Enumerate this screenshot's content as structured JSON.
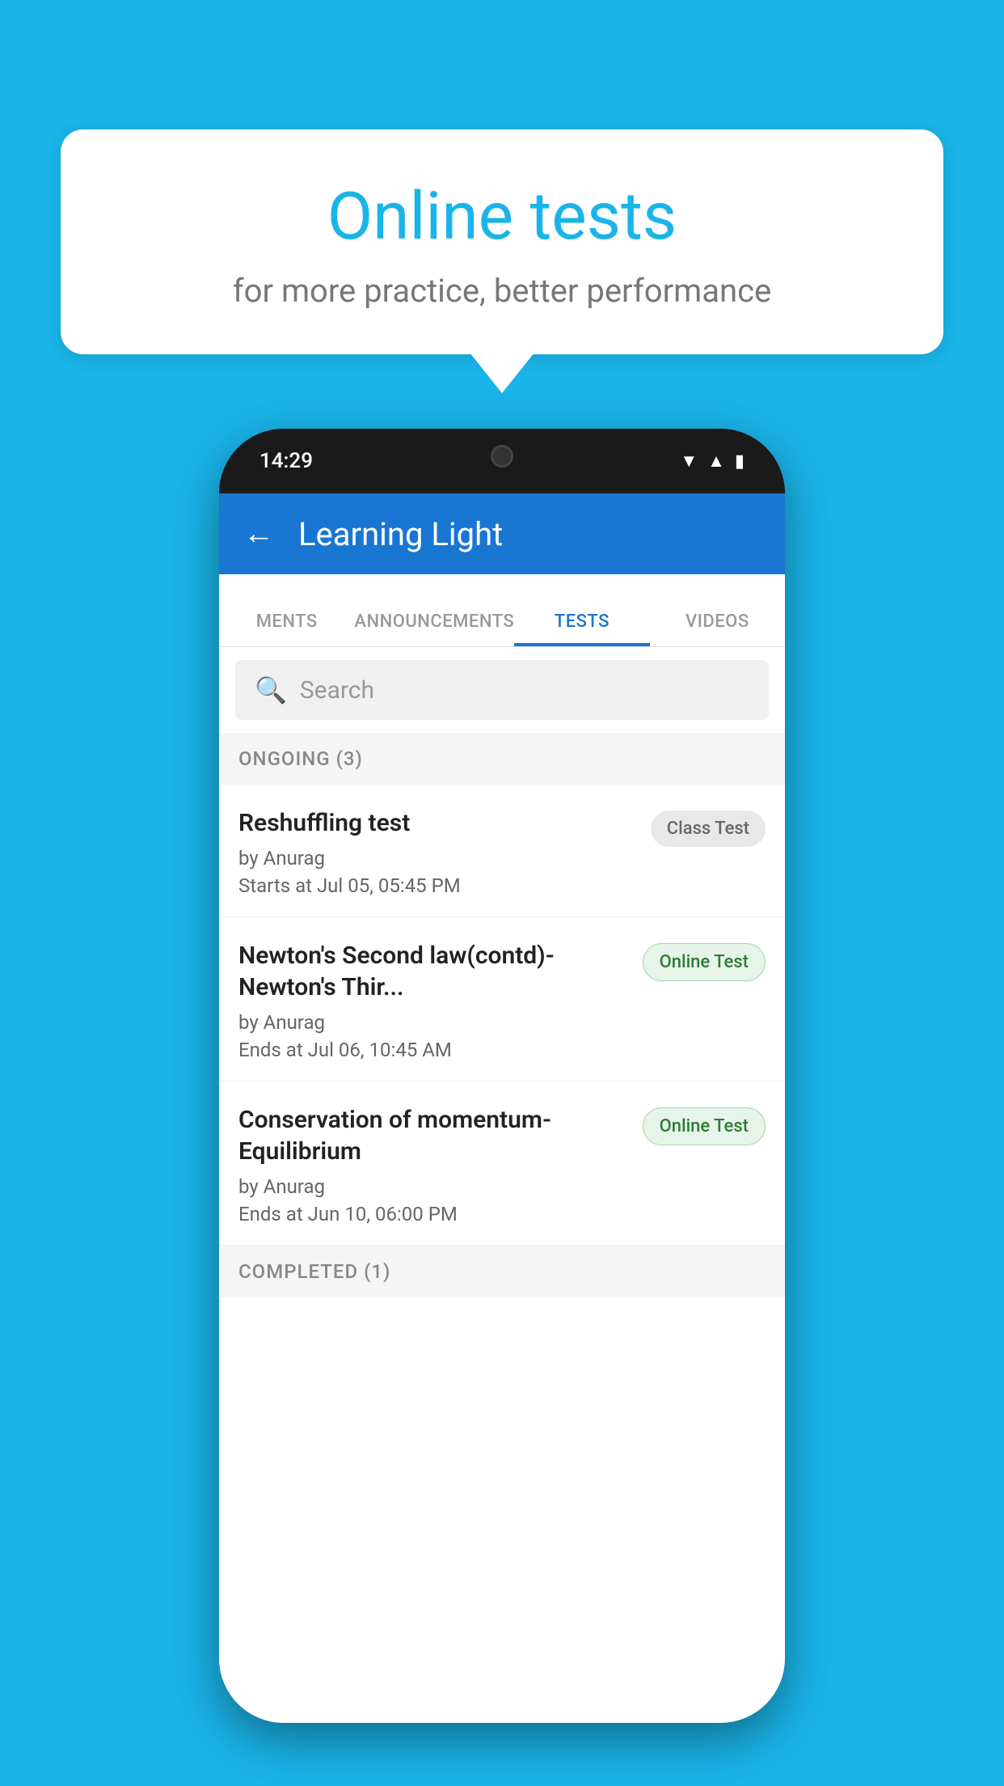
{
  "background": {
    "color": "#1ab4e8"
  },
  "speech_bubble": {
    "title": "Online tests",
    "subtitle": "for more practice, better performance"
  },
  "phone": {
    "status_bar": {
      "time": "14:29",
      "icons": [
        "wifi",
        "signal",
        "battery"
      ]
    },
    "header": {
      "back_label": "←",
      "title": "Learning Light"
    },
    "tabs": [
      {
        "label": "MENTS",
        "active": false
      },
      {
        "label": "ANNOUNCEMENTS",
        "active": false
      },
      {
        "label": "TESTS",
        "active": true
      },
      {
        "label": "VIDEOS",
        "active": false
      }
    ],
    "search": {
      "placeholder": "Search"
    },
    "sections": [
      {
        "label": "ONGOING (3)",
        "tests": [
          {
            "name": "Reshuffling test",
            "author": "by Anurag",
            "time_label": "Starts at",
            "time": "Jul 05, 05:45 PM",
            "badge": "Class Test",
            "badge_type": "class"
          },
          {
            "name": "Newton's Second law(contd)-Newton's Thir...",
            "author": "by Anurag",
            "time_label": "Ends at",
            "time": "Jul 06, 10:45 AM",
            "badge": "Online Test",
            "badge_type": "online"
          },
          {
            "name": "Conservation of momentum-Equilibrium",
            "author": "by Anurag",
            "time_label": "Ends at",
            "time": "Jun 10, 06:00 PM",
            "badge": "Online Test",
            "badge_type": "online"
          }
        ]
      },
      {
        "label": "COMPLETED (1)",
        "tests": []
      }
    ]
  }
}
